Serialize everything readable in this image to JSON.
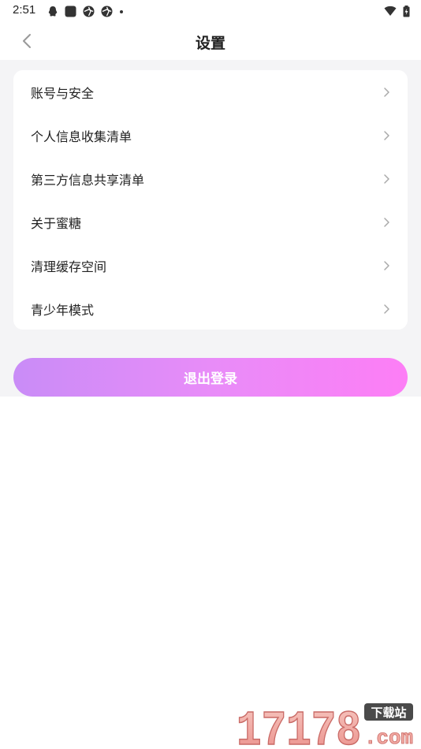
{
  "status_bar": {
    "time": "2:51"
  },
  "header": {
    "title": "设置"
  },
  "settings": {
    "items": [
      {
        "label": "账号与安全"
      },
      {
        "label": "个人信息收集清单"
      },
      {
        "label": "第三方信息共享清单"
      },
      {
        "label": "关于蜜糖"
      },
      {
        "label": "清理缓存空间"
      },
      {
        "label": "青少年模式"
      }
    ]
  },
  "logout": {
    "label": "退出登录"
  },
  "watermark": {
    "number": "17178",
    "tag": "下载站",
    "domain": ".com"
  },
  "colors": {
    "background": "#f4f4f6",
    "card": "#ffffff",
    "gradient_start": "#c98cf7",
    "gradient_end": "#fd7ef6"
  }
}
